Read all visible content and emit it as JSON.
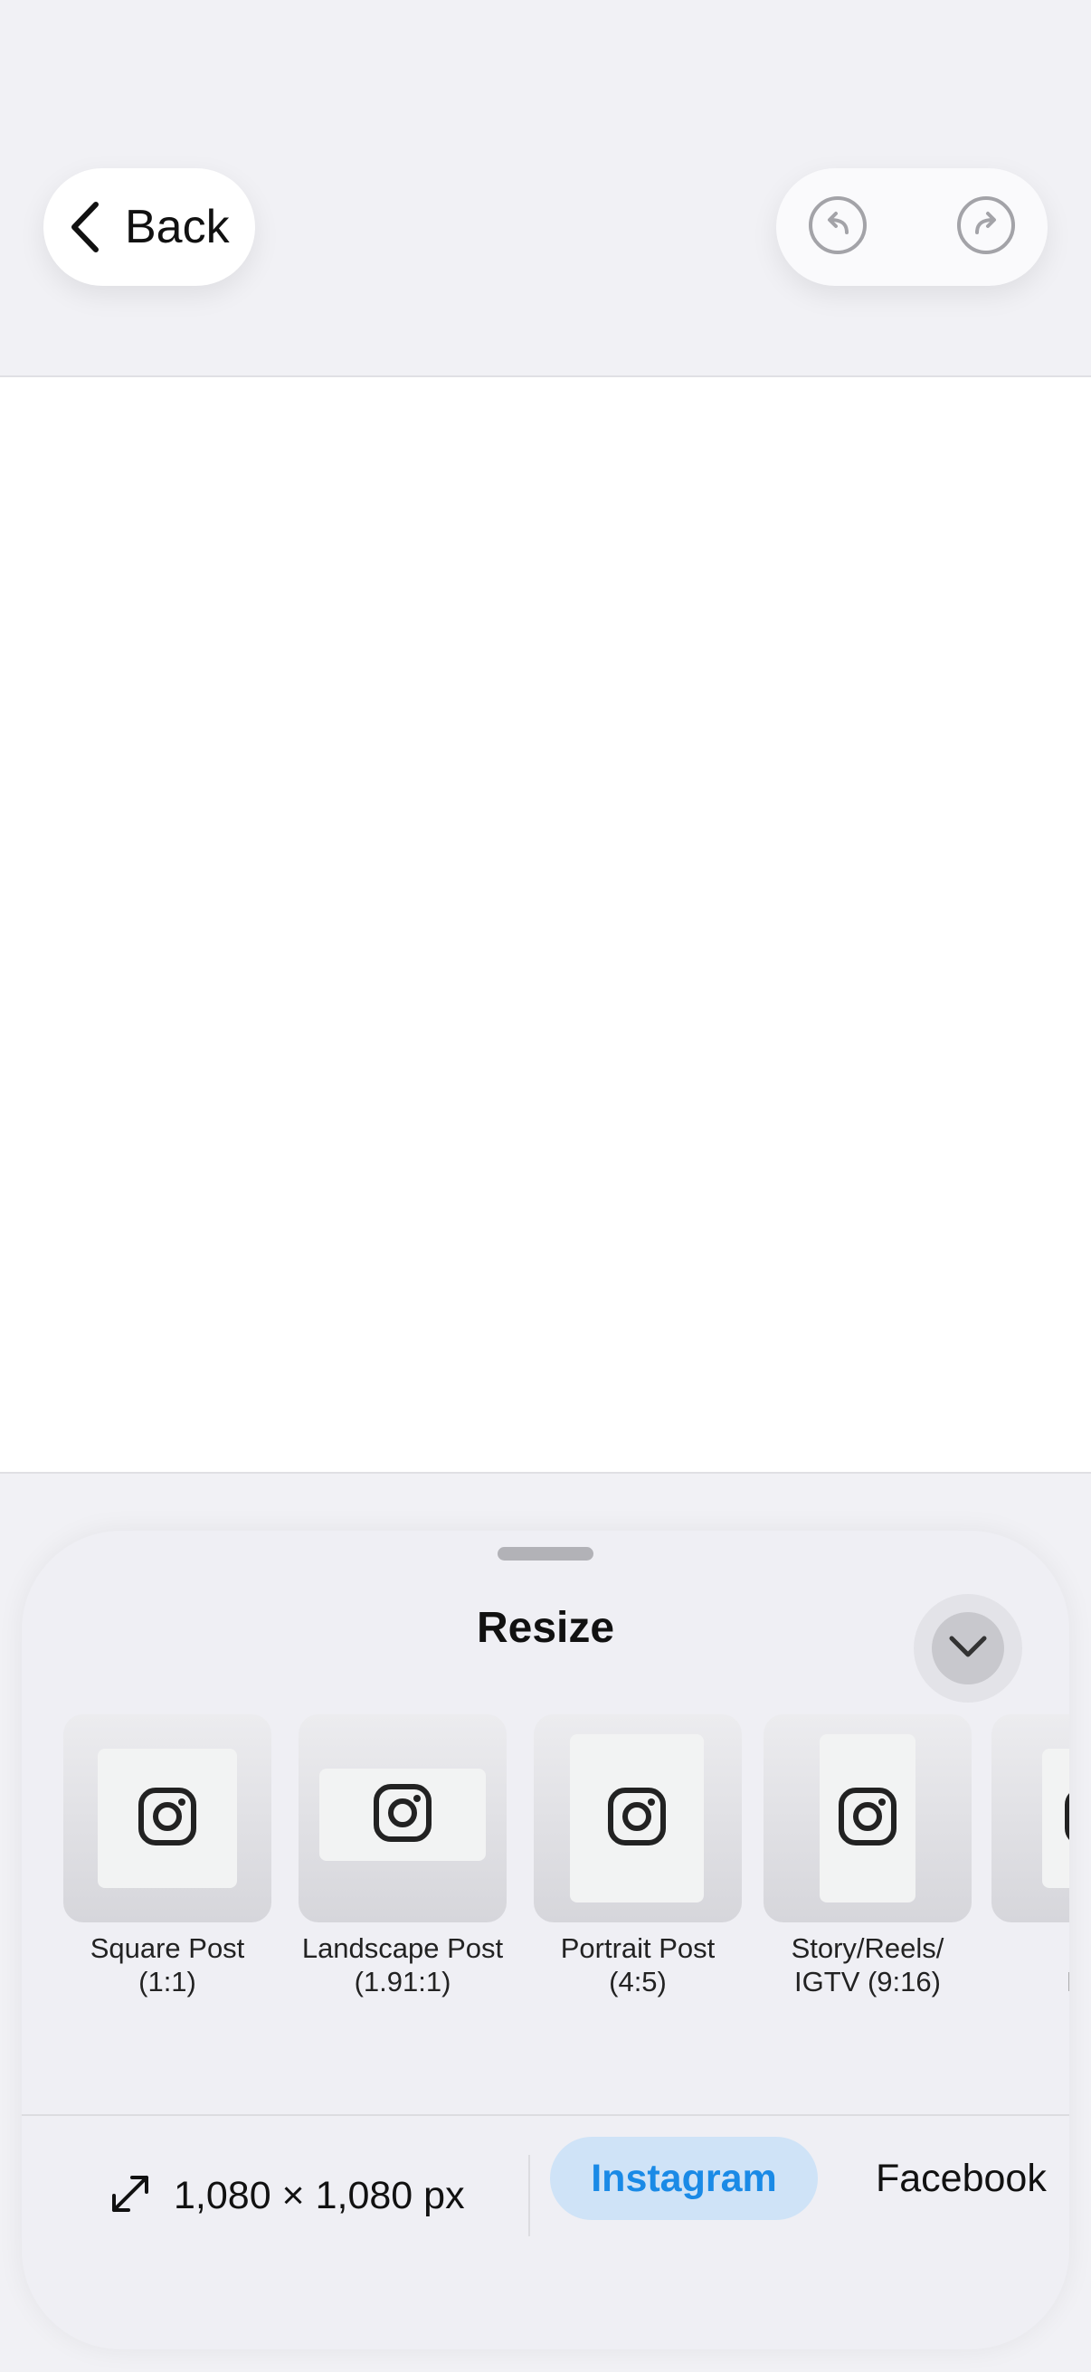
{
  "header": {
    "back_label": "Back",
    "undo_icon": "undo-icon",
    "redo_icon": "redo-icon"
  },
  "sheet": {
    "title": "Resize",
    "collapse_icon": "chevron-down-icon",
    "presets": [
      {
        "label": "Square Post\n(1:1)",
        "icon": "instagram-icon"
      },
      {
        "label": "Landscape Post\n(1.91:1)",
        "icon": "instagram-icon"
      },
      {
        "label": "Portrait Post\n(4:5)",
        "icon": "instagram-icon"
      },
      {
        "label": "Story/Reels/\nIGTV (9:16)",
        "icon": "instagram-icon"
      },
      {
        "label": "inst\nProfi",
        "icon": "instagram-icon"
      }
    ],
    "size_text": "1,080 × 1,080 px",
    "size_icon": "resize-arrows-icon",
    "tabs": [
      "Instagram",
      "Facebook"
    ],
    "selected_tab": "Instagram"
  },
  "colors": {
    "background": "#f1f1f5",
    "canvas": "#ffffff",
    "accent": "#1a8ae6",
    "accent_bg": "#cfe3f7"
  }
}
